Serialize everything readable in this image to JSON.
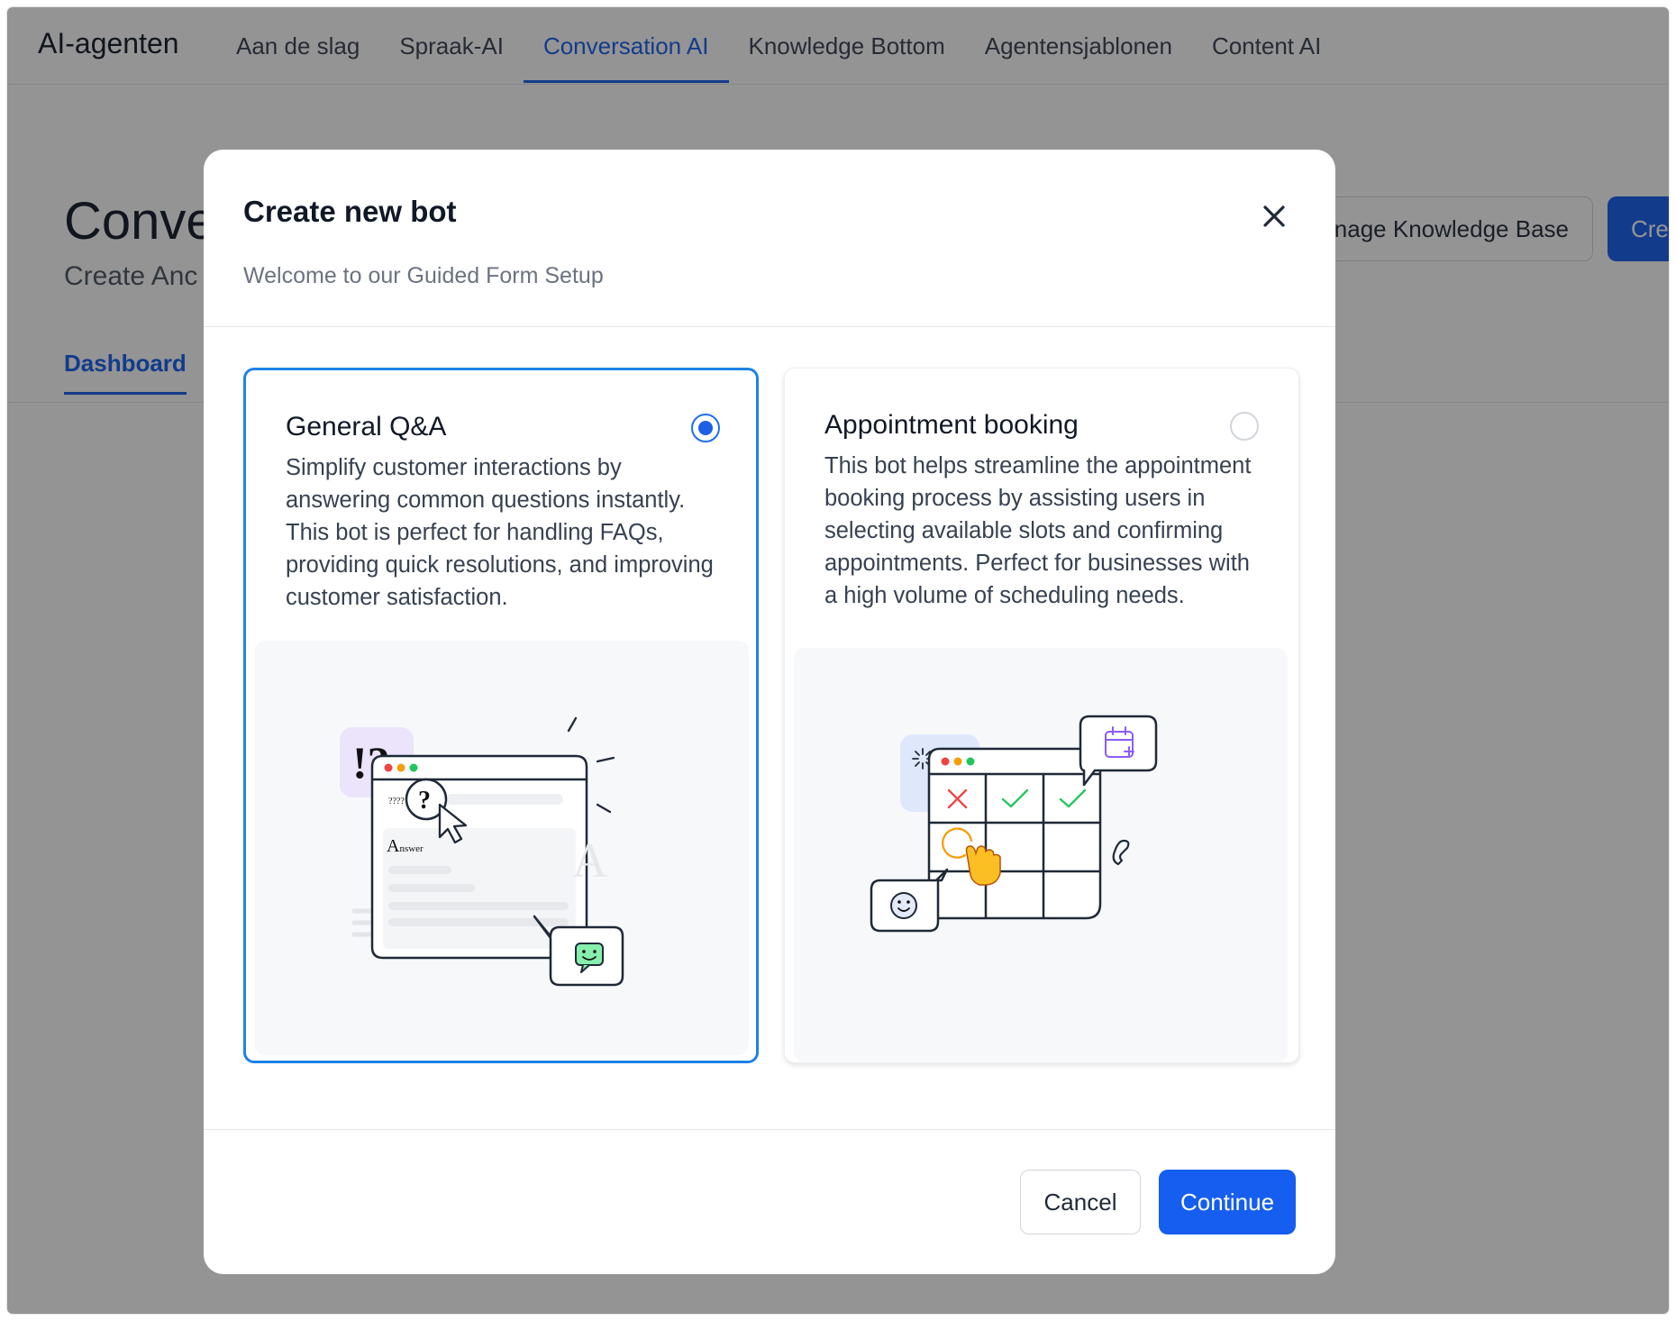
{
  "app": {
    "brand": "AI-agenten",
    "nav_tabs": [
      {
        "label": "Aan de slag",
        "active": false
      },
      {
        "label": "Spraak-AI",
        "active": false
      },
      {
        "label": "Conversation AI",
        "active": true
      },
      {
        "label": "Knowledge Bottom",
        "active": false
      },
      {
        "label": "Agentensjablonen",
        "active": false
      },
      {
        "label": "Content AI",
        "active": false
      }
    ],
    "page_title": "Conve",
    "page_subtitle": "Create Anc",
    "subtab": "Dashboard",
    "kb_button": "anage Knowledge Base",
    "create_button": "Crea",
    "accent": "#155eef"
  },
  "modal": {
    "title": "Create new bot",
    "subtitle": "Welcome to our Guided Form Setup",
    "cards": [
      {
        "title": "General Q&A",
        "description": "Simplify customer interactions by answering common questions instantly. This bot is perfect for handling FAQs, providing quick resolutions, and improving customer satisfaction.",
        "selected": true,
        "illustration": {
          "badge": "!?",
          "question_marks": "????",
          "answer_label": "Answer",
          "answer_initial": "A",
          "answer_rest": "nswer"
        }
      },
      {
        "title": "Appointment booking",
        "description": "This bot helps streamline the appointment booking process by assisting users in selecting available slots and confirming appointments. Perfect for businesses with a high volume of scheduling needs.",
        "selected": false,
        "illustration": {
          "icons": [
            "calendar-plus-icon",
            "cross-icon",
            "check-icon",
            "hand-pointer-icon",
            "smiley-icon",
            "phone-icon"
          ]
        }
      }
    ],
    "buttons": {
      "cancel": "Cancel",
      "continue": "Continue"
    },
    "selected_border_color": "#1d82e8"
  }
}
